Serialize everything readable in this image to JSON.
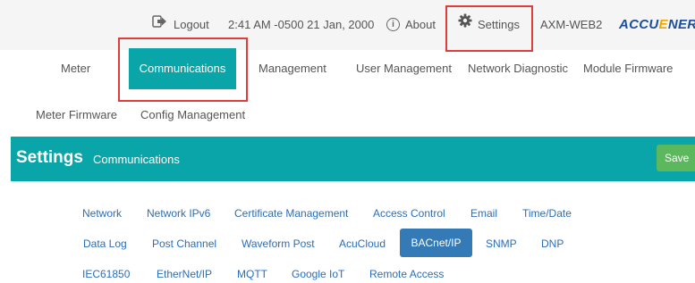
{
  "topbar": {
    "logout": "Logout",
    "datetime": "2:41 AM -0500 21 Jan, 2000",
    "about": "About",
    "settings": "Settings",
    "device": "AXM-WEB2",
    "logo_part1": "ACCU",
    "logo_part2": "E",
    "logo_part3": "NERGY"
  },
  "nav": {
    "items": [
      "Meter",
      "Communications",
      "Management",
      "User Management",
      "Network Diagnostic",
      "Module Firmware",
      "Meter Firmware",
      "Config Management"
    ],
    "active": "Communications"
  },
  "header": {
    "title": "Settings",
    "subtitle": "Communications",
    "save": "Save"
  },
  "subnav": {
    "items": [
      "Network",
      "Network IPv6",
      "Certificate Management",
      "Access Control",
      "Email",
      "Time/Date",
      "Data Log",
      "Post Channel",
      "Waveform Post",
      "AcuCloud",
      "BACnet/IP",
      "SNMP",
      "DNP",
      "IEC61850",
      "EtherNet/IP",
      "MQTT",
      "Google IoT",
      "Remote Access"
    ],
    "active": "BACnet/IP"
  },
  "colors": {
    "accent": "#0aa5a9",
    "active_tab": "#337ab7",
    "save": "#5cb85c",
    "highlight": "#e03c3c",
    "link": "#2a6ebb"
  },
  "icons": {
    "logout": "sign-out-icon",
    "about": "info-circle-icon",
    "settings": "gear-icon"
  }
}
